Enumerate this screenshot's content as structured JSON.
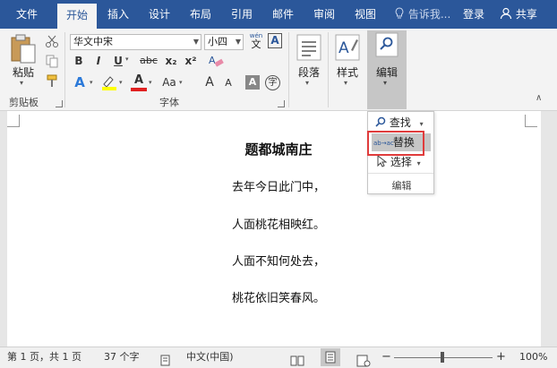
{
  "tabs": [
    {
      "label": "文件"
    },
    {
      "label": "开始"
    },
    {
      "label": "插入"
    },
    {
      "label": "设计"
    },
    {
      "label": "布局"
    },
    {
      "label": "引用"
    },
    {
      "label": "邮件"
    },
    {
      "label": "审阅"
    },
    {
      "label": "视图"
    }
  ],
  "tell_me": "告诉我...",
  "login": "登录",
  "share": "共享",
  "ribbon": {
    "clipboard": {
      "paste": "粘贴",
      "label": "剪贴板"
    },
    "font": {
      "name": "华文中宋",
      "size": "小四",
      "label": "字体",
      "wen": "wén",
      "wen_char": "文",
      "zi_char": "字",
      "aa": "Aa",
      "bold": "B",
      "italic": "I",
      "underline": "U",
      "strike": "abc",
      "sub": "x₂",
      "sup": "x²",
      "fonta": "A",
      "grow": "A",
      "shrink": "A"
    },
    "paragraph": {
      "label": "段落"
    },
    "styles": {
      "label": "样式"
    },
    "editing": {
      "label": "编辑"
    }
  },
  "dropdown": {
    "find": "查找",
    "replace": "替换",
    "replace_icon_text": "ab→ac",
    "select": "选择",
    "group_label": "编辑"
  },
  "document": {
    "title": "题都城南庄",
    "lines": [
      "去年今日此门中，",
      "人面桃花相映红。",
      "人面不知何处去，",
      "桃花依旧笑春风。"
    ]
  },
  "status": {
    "page": "第 1 页，共 1 页",
    "words": "37 个字",
    "language": "中文(中国)",
    "zoom": "100%",
    "zoom_minus": "−",
    "zoom_plus": "+"
  },
  "colors": {
    "title_bar": "#2b579a",
    "ribbon": "#f3f3f3",
    "highlight": "#e03c3c",
    "font_color": "#e02020",
    "highlight_color": "#ffff00"
  }
}
